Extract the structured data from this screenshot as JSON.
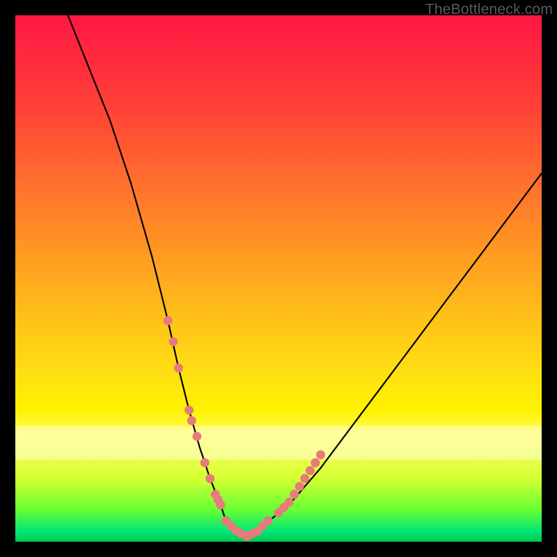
{
  "watermark": "TheBottleneck.com",
  "chart_data": {
    "type": "line",
    "title": "",
    "xlabel": "",
    "ylabel": "",
    "xlim": [
      0,
      100
    ],
    "ylim": [
      0,
      100
    ],
    "grid": false,
    "series": [
      {
        "name": "bottleneck-curve",
        "x": [
          10,
          14,
          18,
          22,
          26,
          29,
          31,
          33,
          35,
          37,
          39,
          40,
          42,
          44,
          47,
          52,
          58,
          64,
          70,
          76,
          82,
          88,
          94,
          100
        ],
        "values": [
          100,
          90,
          80,
          68,
          54,
          42,
          33,
          25,
          18,
          12,
          7,
          4,
          2,
          1,
          3,
          7,
          14,
          22,
          30,
          38,
          46,
          54,
          62,
          70
        ]
      }
    ],
    "markers": {
      "name": "highlight-dots",
      "color": "#e77b7b",
      "x": [
        29,
        30,
        31,
        33,
        33.5,
        34.5,
        36,
        37,
        38,
        38.5,
        39,
        40,
        41,
        42,
        43,
        44,
        45,
        46,
        47,
        48,
        50,
        51,
        52,
        53,
        54,
        55,
        56,
        57,
        58
      ],
      "values": [
        42,
        38,
        33,
        25,
        23,
        20,
        15,
        12,
        9,
        8,
        7,
        4,
        3,
        2,
        1.5,
        1,
        1.5,
        2,
        3,
        4,
        5.5,
        6.5,
        7.5,
        9,
        10.5,
        12,
        13.5,
        15,
        16.5
      ]
    },
    "gradient_colors": {
      "top": "#ff1744",
      "mid_upper": "#ff8f25",
      "mid": "#ffe012",
      "mid_lower": "#d4ff33",
      "bottom": "#00c853"
    },
    "pale_band": {
      "y_start": 78,
      "y_end": 85
    }
  }
}
